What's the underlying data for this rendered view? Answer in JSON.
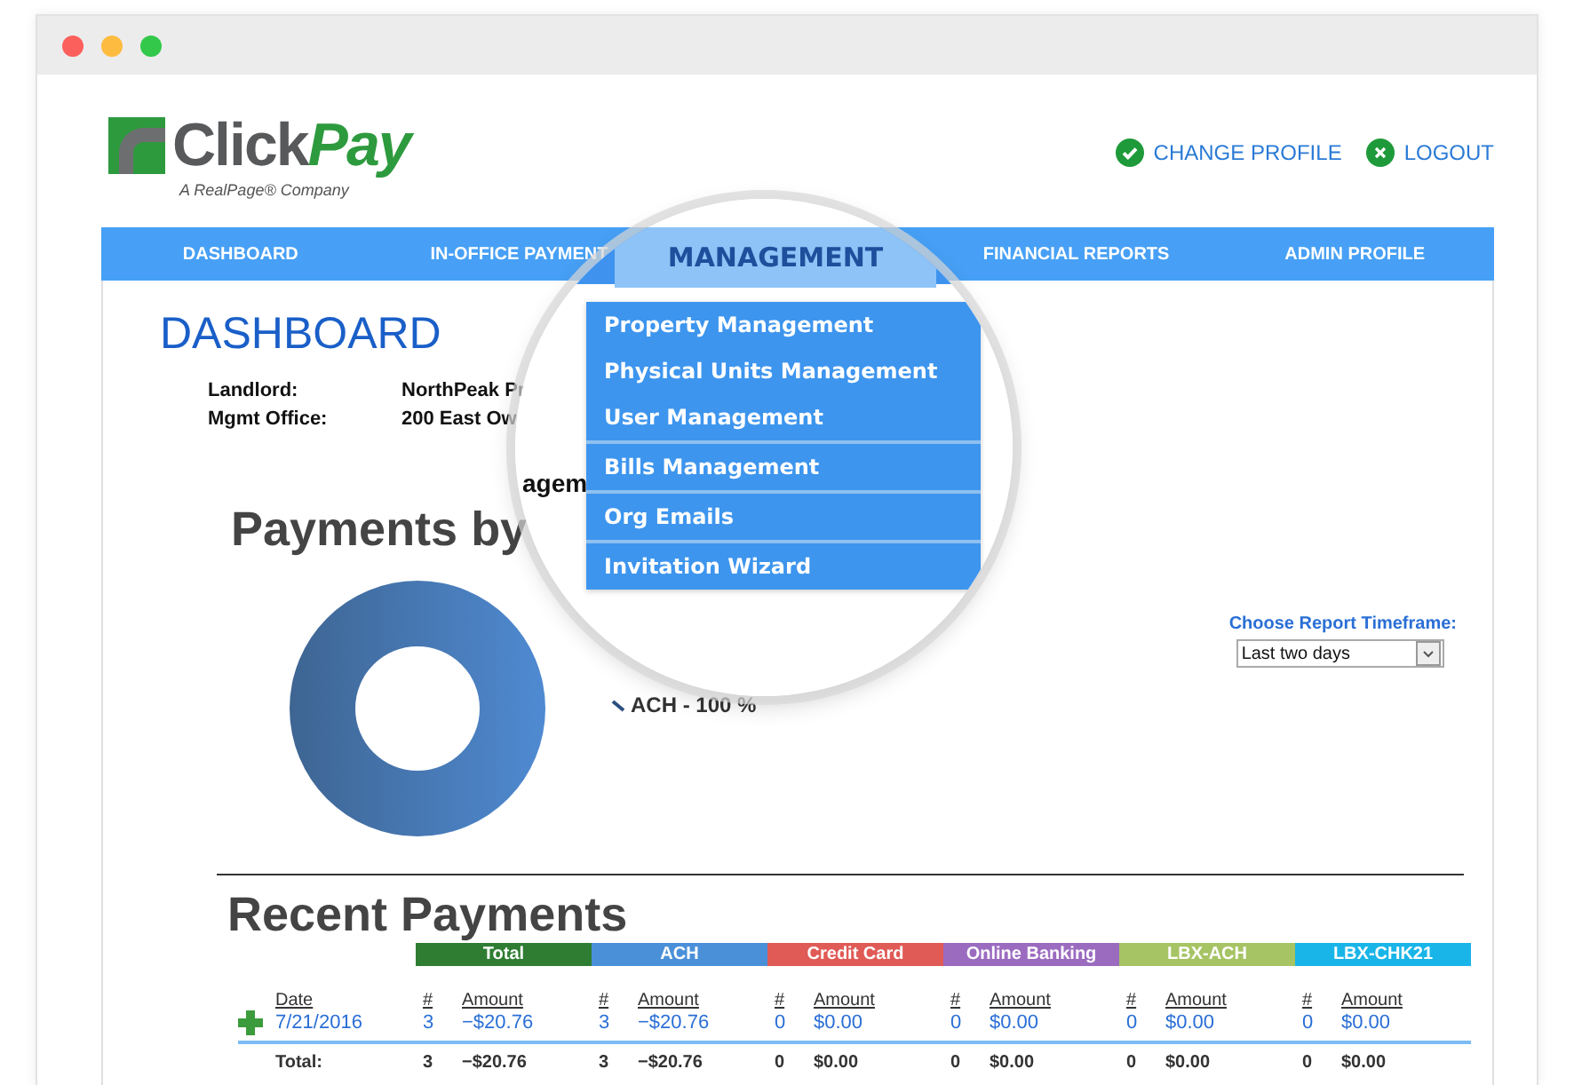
{
  "window": {
    "controls": [
      {
        "color": "#fc605c"
      },
      {
        "color": "#fdbc40"
      },
      {
        "color": "#34c84a"
      }
    ]
  },
  "logo": {
    "name_start": "Click",
    "name_end": "Pay",
    "tagline": "A RealPage® Company"
  },
  "header_links": [
    {
      "kind": "check",
      "label": "CHANGE PROFILE"
    },
    {
      "kind": "close",
      "label": "LOGOUT"
    }
  ],
  "nav": {
    "items": [
      {
        "label": "DASHBOARD",
        "selected": false
      },
      {
        "label": "IN-OFFICE PAYMENT",
        "selected": false
      },
      {
        "label": "MANAGEMENT",
        "selected": true
      },
      {
        "label": "FINANCIAL REPORTS",
        "selected": false
      },
      {
        "label": "ADMIN PROFILE",
        "selected": false
      }
    ],
    "menu": {
      "items": [
        {
          "label": "Property Management",
          "separated": false
        },
        {
          "label": "Physical Units Management",
          "separated": false
        },
        {
          "label": "User Management",
          "separated": false
        },
        {
          "label": "Bills Management",
          "separated": true
        },
        {
          "label": "Org Emails",
          "separated": true
        },
        {
          "label": "Invitation Wizard",
          "separated": true
        }
      ]
    }
  },
  "page_title": "DASHBOARD",
  "info": [
    {
      "label": "Landlord:",
      "value": "NorthPeak Pr"
    },
    {
      "label": "Mgmt Office:",
      "value": "200 East Ow"
    }
  ],
  "lens_heading": "agem",
  "payments": {
    "title": "Payments by",
    "legend": "ACH - 100 %"
  },
  "timeframe": {
    "label": "Choose Report Timeframe:",
    "value": "Last two days"
  },
  "recent": {
    "title": "Recent Payments",
    "date_header": "Date",
    "groups": [
      {
        "label": "Total",
        "color": "#2e7d32",
        "count_header": "#",
        "amount_header": "Amount"
      },
      {
        "label": "ACH",
        "color": "#4a90d9",
        "count_header": "#",
        "amount_header": "Amount"
      },
      {
        "label": "Credit Card",
        "color": "#e05a56",
        "count_header": "#",
        "amount_header": "Amount"
      },
      {
        "label": "Online Banking",
        "color": "#9b6bc0",
        "count_header": "#",
        "amount_header": "Amount"
      },
      {
        "label": "LBX-ACH",
        "color": "#a6c464",
        "count_header": "#",
        "amount_header": "Amount"
      },
      {
        "label": "LBX-CHK21",
        "color": "#1ab5e8",
        "count_header": "#",
        "amount_header": "Amount"
      }
    ],
    "rows": [
      {
        "date": "7/21/2016",
        "cells": [
          {
            "count": "3",
            "amount": "−$20.76"
          },
          {
            "count": "3",
            "amount": "−$20.76"
          },
          {
            "count": "0",
            "amount": "$0.00"
          },
          {
            "count": "0",
            "amount": "$0.00"
          },
          {
            "count": "0",
            "amount": "$0.00"
          },
          {
            "count": "0",
            "amount": "$0.00"
          }
        ]
      }
    ],
    "total": {
      "label": "Total:",
      "cells": [
        {
          "count": "3",
          "amount": "−$20.76"
        },
        {
          "count": "3",
          "amount": "−$20.76"
        },
        {
          "count": "0",
          "amount": "$0.00"
        },
        {
          "count": "0",
          "amount": "$0.00"
        },
        {
          "count": "0",
          "amount": "$0.00"
        },
        {
          "count": "0",
          "amount": "$0.00"
        }
      ]
    }
  }
}
